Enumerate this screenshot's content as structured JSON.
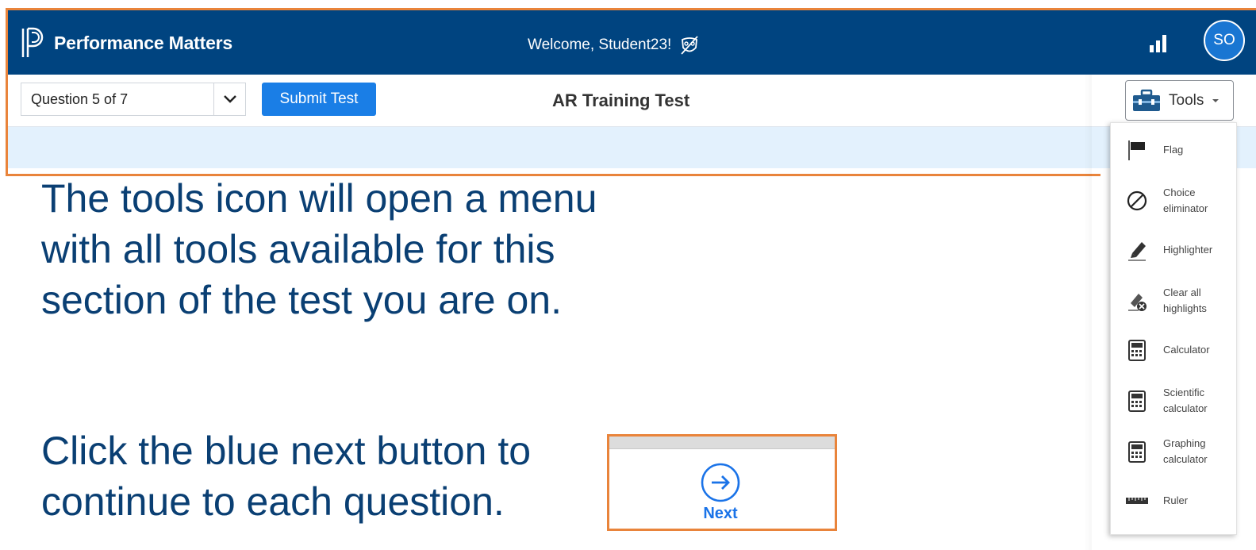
{
  "app": {
    "brand": "Performance Matters",
    "welcome": "Welcome, Student23!",
    "avatar_initials": "SO"
  },
  "toolbar": {
    "question_select": "Question 5 of 7",
    "submit_label": "Submit Test",
    "test_title": "AR Training Test",
    "tools_label": "Tools"
  },
  "tools_menu": {
    "items": [
      {
        "label": "Flag",
        "icon": "flag-icon"
      },
      {
        "label": "Choice eliminator",
        "icon": "choice-eliminator-icon"
      },
      {
        "label": "Highlighter",
        "icon": "highlighter-icon"
      },
      {
        "label": "Clear all highlights",
        "icon": "clear-highlights-icon"
      },
      {
        "label": "Calculator",
        "icon": "calculator-icon"
      },
      {
        "label": "Scientific calculator",
        "icon": "scientific-calculator-icon"
      },
      {
        "label": "Graphing calculator",
        "icon": "graphing-calculator-icon"
      },
      {
        "label": "Ruler",
        "icon": "ruler-icon"
      }
    ]
  },
  "instructions": {
    "tools_text": "The tools icon will open a menu with all tools available for this section of the test you are on.",
    "next_text": "Click the blue next button to continue to each question."
  },
  "next_button": {
    "label": "Next"
  },
  "colors": {
    "header": "#004480",
    "accent": "#1a7ee6",
    "highlight_border": "#e9843b",
    "instruction_text": "#0a3f73"
  }
}
